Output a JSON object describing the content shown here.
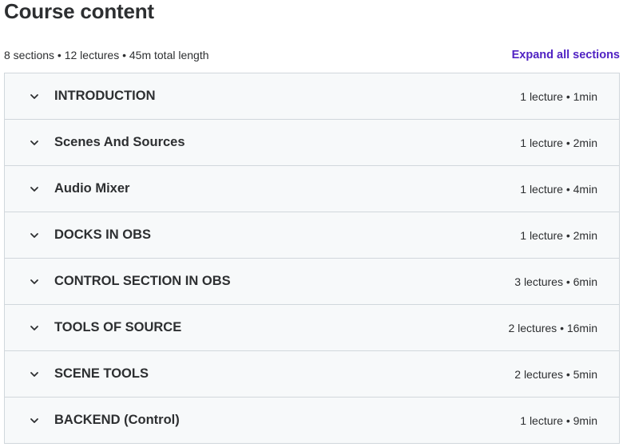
{
  "header": {
    "title": "Course content",
    "summary": "8 sections • 12 lectures • 45m total length",
    "expand_label": "Expand all sections"
  },
  "sections": [
    {
      "title": "INTRODUCTION",
      "meta": "1 lecture • 1min"
    },
    {
      "title": "Scenes And Sources",
      "meta": "1 lecture • 2min"
    },
    {
      "title": "Audio Mixer",
      "meta": "1 lecture • 4min"
    },
    {
      "title": "DOCKS IN OBS",
      "meta": "1 lecture • 2min"
    },
    {
      "title": "CONTROL SECTION IN OBS",
      "meta": "3 lectures • 6min"
    },
    {
      "title": "TOOLS OF SOURCE",
      "meta": "2 lectures • 16min"
    },
    {
      "title": "SCENE TOOLS",
      "meta": "2 lectures • 5min"
    },
    {
      "title": "BACKEND (Control)",
      "meta": "1 lecture • 9min"
    }
  ],
  "icons": {
    "section_toggle": "chevron-down-icon"
  },
  "colors": {
    "accent": "#5022c3",
    "section_bg": "#f7f9fa",
    "border": "#d1d7dc",
    "text": "#2d2f31"
  }
}
